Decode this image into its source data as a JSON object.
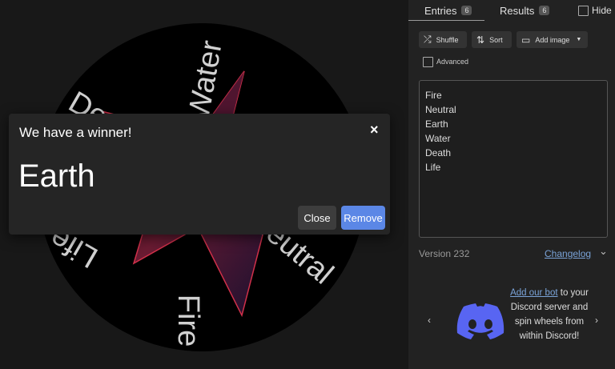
{
  "wheel": {
    "segments": [
      "Water",
      "Neutral",
      "Fire",
      "Life",
      "Death",
      "Earth"
    ]
  },
  "dialog": {
    "title": "We have a winner!",
    "close_icon": "×",
    "winner": "Earth",
    "close_label": "Close",
    "remove_label": "Remove"
  },
  "tabs": [
    {
      "label": "Entries",
      "count": "6"
    },
    {
      "label": "Results",
      "count": "6"
    }
  ],
  "hide_label": "Hide",
  "toolbar": {
    "shuffle_label": "Shuffle",
    "sort_label": "Sort",
    "add_image_label": "Add image"
  },
  "advanced_label": "Advanced",
  "entries": [
    "Fire",
    "Neutral",
    "Earth",
    "Water",
    "Death",
    "Life"
  ],
  "version": "Version 232",
  "changelog": "Changelog",
  "promo": {
    "link": "Add our bot",
    "text": "to your Discord server and spin wheels from within Discord!"
  },
  "colors": {
    "accent": "#5b87e6",
    "link": "#7aa3d8",
    "discord": "#5865f2"
  }
}
